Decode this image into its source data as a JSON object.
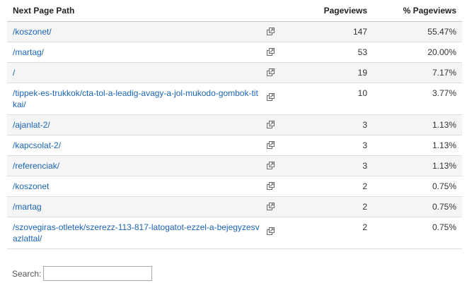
{
  "table": {
    "headers": {
      "path": "Next Page Path",
      "pageviews": "Pageviews",
      "pct": "% Pageviews"
    },
    "rows": [
      {
        "path": "/koszonet/",
        "pageviews": "147",
        "pct": "55.47%"
      },
      {
        "path": "/martag/",
        "pageviews": "53",
        "pct": "20.00%"
      },
      {
        "path": "/",
        "pageviews": "19",
        "pct": "7.17%"
      },
      {
        "path": "/tippek-es-trukkok/cta-tol-a-leadig-avagy-a-jol-mukodo-gombok-titkai/",
        "pageviews": "10",
        "pct": "3.77%"
      },
      {
        "path": "/ajanlat-2/",
        "pageviews": "3",
        "pct": "1.13%"
      },
      {
        "path": "/kapcsolat-2/",
        "pageviews": "3",
        "pct": "1.13%"
      },
      {
        "path": "/referenciak/",
        "pageviews": "3",
        "pct": "1.13%"
      },
      {
        "path": "/koszonet",
        "pageviews": "2",
        "pct": "0.75%"
      },
      {
        "path": "/martag",
        "pageviews": "2",
        "pct": "0.75%"
      },
      {
        "path": "/szovegiras-otletek/szerezz-113-817-latogatot-ezzel-a-bejegyzesvazlattal/",
        "pageviews": "2",
        "pct": "0.75%"
      }
    ],
    "row_icon": "external-link-icon"
  },
  "search": {
    "label": "Search:",
    "value": "",
    "placeholder": ""
  },
  "colors": {
    "link": "#1a64b4",
    "row_alt": "#f5f5f5"
  }
}
